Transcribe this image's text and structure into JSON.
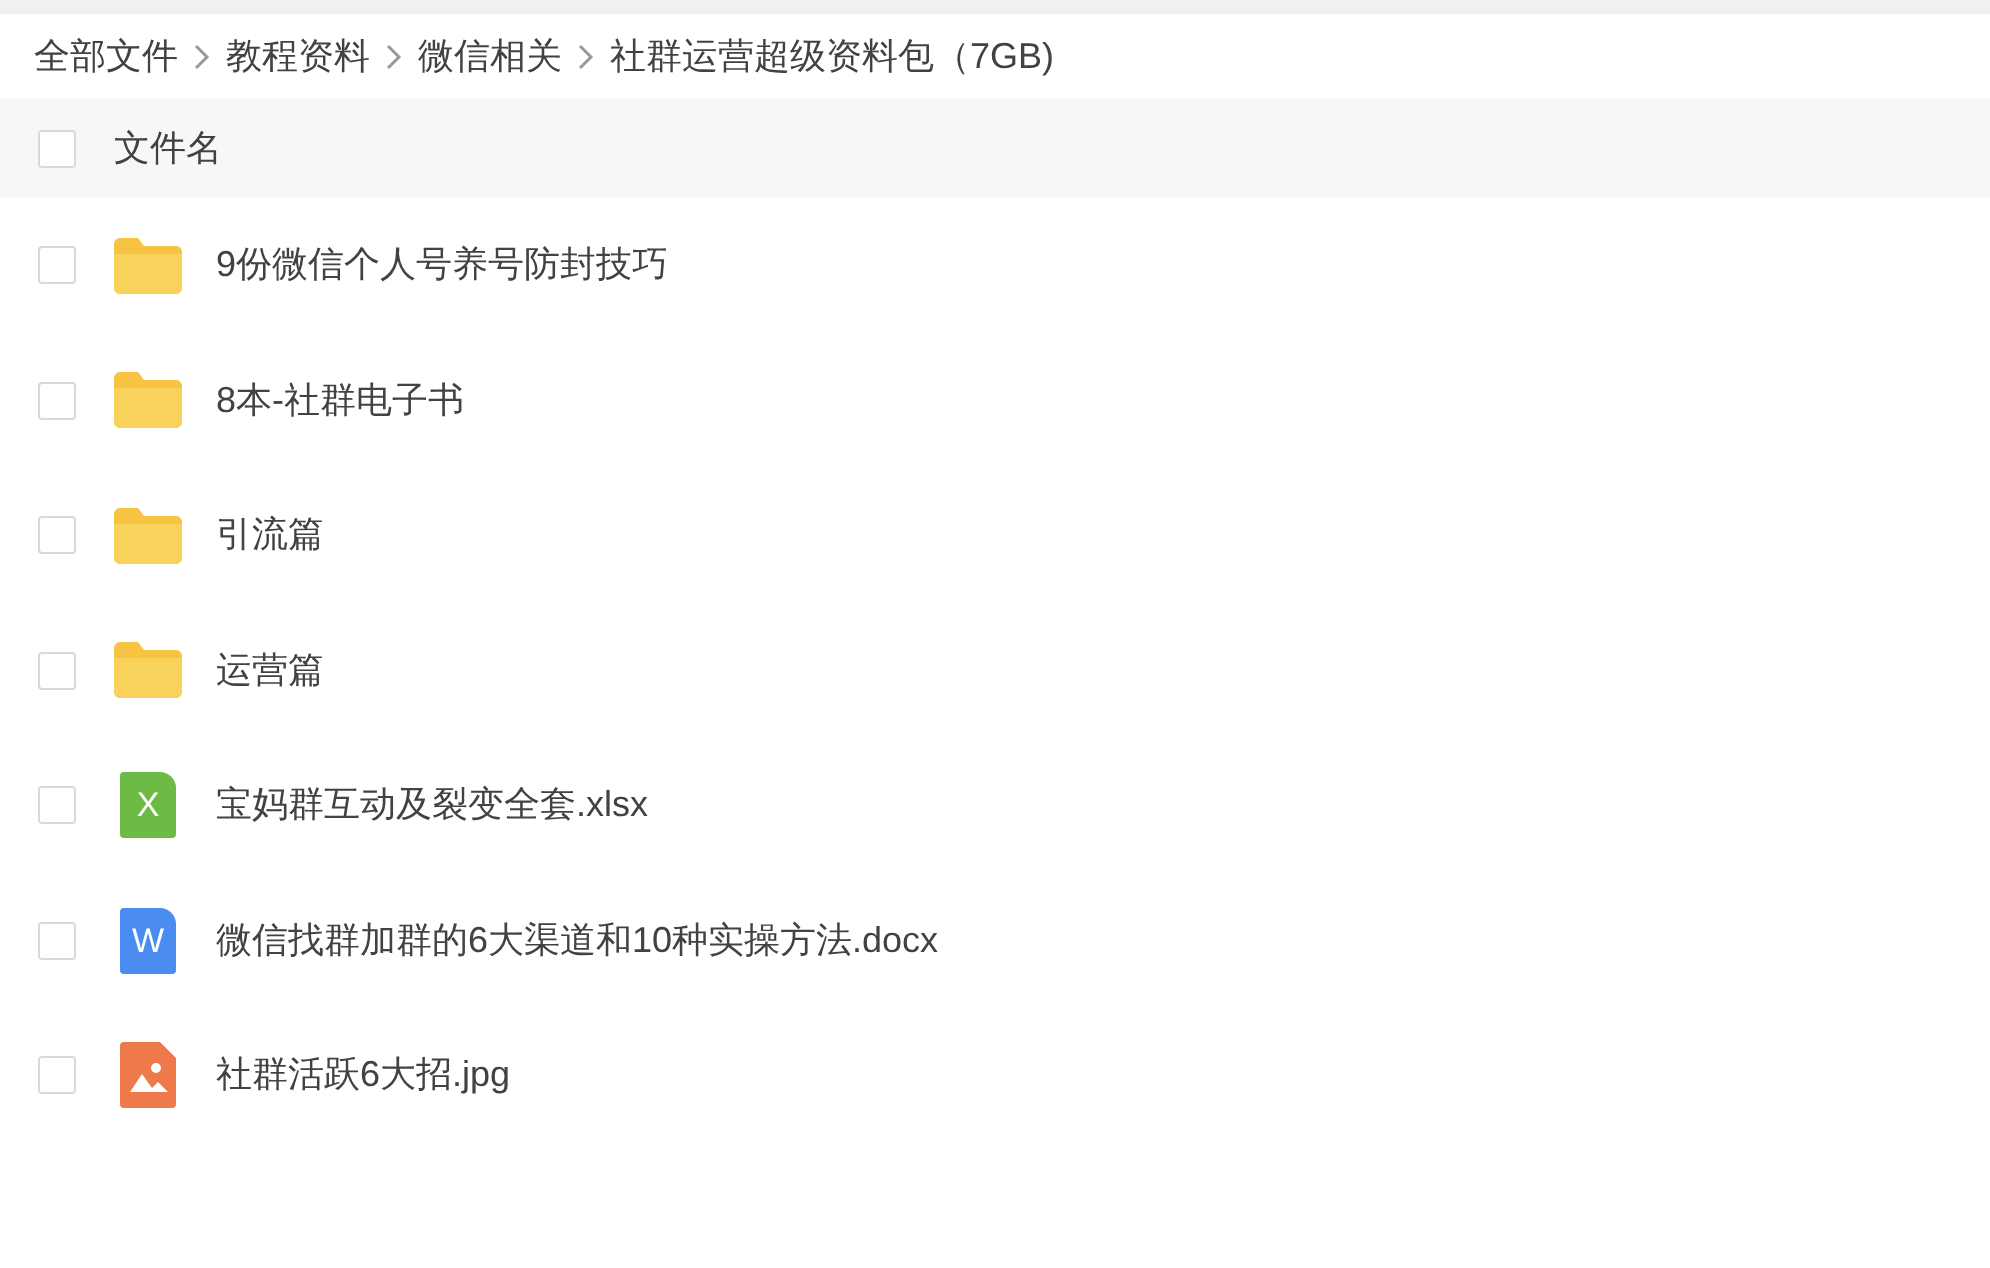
{
  "breadcrumb": [
    "全部文件",
    "教程资料",
    "微信相关",
    "社群运营超级资料包（7GB)"
  ],
  "header": {
    "label": "文件名",
    "checked": false
  },
  "files": [
    {
      "kind": "folder",
      "name": "9份微信个人号养号防封技巧",
      "checked": false
    },
    {
      "kind": "folder",
      "name": "8本-社群电子书",
      "checked": false
    },
    {
      "kind": "folder",
      "name": "引流篇",
      "checked": false
    },
    {
      "kind": "folder",
      "name": "运营篇",
      "checked": false
    },
    {
      "kind": "sheet",
      "icon_letter": "X",
      "name": "宝妈群互动及裂变全套.xlsx",
      "checked": false
    },
    {
      "kind": "doc",
      "icon_letter": "W",
      "name": "微信找群加群的6大渠道和10种实操方法.docx",
      "checked": false
    },
    {
      "kind": "image",
      "name": "社群活跃6大招.jpg",
      "checked": false
    }
  ]
}
